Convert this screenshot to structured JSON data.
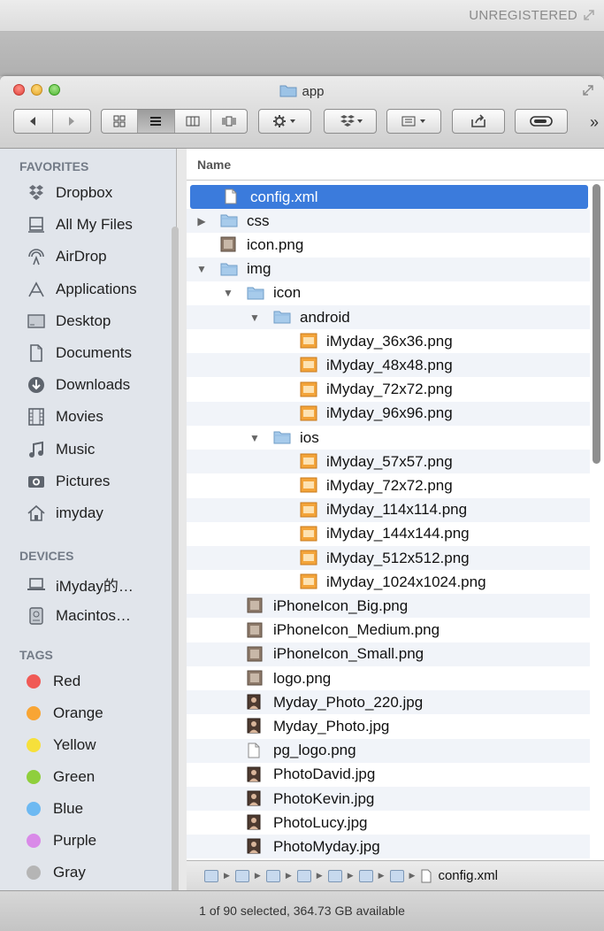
{
  "top": {
    "unregistered": "UNREGISTERED"
  },
  "window": {
    "title": "app",
    "more": "»"
  },
  "sidebar": {
    "favorites_header": "FAVORITES",
    "favorites": [
      {
        "label": "Dropbox",
        "icon": "dropbox-icon"
      },
      {
        "label": "All My Files",
        "icon": "all-my-files-icon"
      },
      {
        "label": "AirDrop",
        "icon": "airdrop-icon"
      },
      {
        "label": "Applications",
        "icon": "applications-icon"
      },
      {
        "label": "Desktop",
        "icon": "desktop-icon"
      },
      {
        "label": "Documents",
        "icon": "documents-icon"
      },
      {
        "label": "Downloads",
        "icon": "downloads-icon"
      },
      {
        "label": "Movies",
        "icon": "movies-icon"
      },
      {
        "label": "Music",
        "icon": "music-icon"
      },
      {
        "label": "Pictures",
        "icon": "pictures-icon"
      },
      {
        "label": "imyday",
        "icon": "home-icon"
      }
    ],
    "devices_header": "DEVICES",
    "devices": [
      {
        "label": "iMyday的…",
        "icon": "laptop-icon"
      },
      {
        "label": "Macintos…",
        "icon": "hard-drive-icon"
      }
    ],
    "tags_header": "TAGS",
    "tags": [
      {
        "label": "Red",
        "color": "#f05a56"
      },
      {
        "label": "Orange",
        "color": "#f8a534"
      },
      {
        "label": "Yellow",
        "color": "#f6e03b"
      },
      {
        "label": "Green",
        "color": "#8fcf3c"
      },
      {
        "label": "Blue",
        "color": "#6db9f2"
      },
      {
        "label": "Purple",
        "color": "#d98ae8"
      },
      {
        "label": "Gray",
        "color": "#b5b5b5"
      }
    ]
  },
  "files": {
    "column_name": "Name",
    "rows": [
      {
        "name": "config.xml",
        "type": "doc",
        "selected": true
      },
      {
        "name": "css",
        "type": "folder",
        "disclosure": "closed"
      },
      {
        "name": "icon.png",
        "type": "image"
      },
      {
        "name": "img",
        "type": "folder",
        "disclosure": "open"
      },
      {
        "name": "icon",
        "type": "folder",
        "disclosure": "open"
      },
      {
        "name": "android",
        "type": "folder",
        "disclosure": "open"
      },
      {
        "name": "iMyday_36x36.png",
        "type": "orange"
      },
      {
        "name": "iMyday_48x48.png",
        "type": "orange"
      },
      {
        "name": "iMyday_72x72.png",
        "type": "orange"
      },
      {
        "name": "iMyday_96x96.png",
        "type": "orange"
      },
      {
        "name": "ios",
        "type": "folder",
        "disclosure": "open"
      },
      {
        "name": "iMyday_57x57.png",
        "type": "orange"
      },
      {
        "name": "iMyday_72x72.png",
        "type": "orange"
      },
      {
        "name": "iMyday_114x114.png",
        "type": "orange"
      },
      {
        "name": "iMyday_144x144.png",
        "type": "orange"
      },
      {
        "name": "iMyday_512x512.png",
        "type": "orange"
      },
      {
        "name": "iMyday_1024x1024.png",
        "type": "orange"
      },
      {
        "name": "iPhoneIcon_Big.png",
        "type": "image"
      },
      {
        "name": "iPhoneIcon_Medium.png",
        "type": "image"
      },
      {
        "name": "iPhoneIcon_Small.png",
        "type": "image"
      },
      {
        "name": "logo.png",
        "type": "image"
      },
      {
        "name": "Myday_Photo_220.jpg",
        "type": "photo"
      },
      {
        "name": "Myday_Photo.jpg",
        "type": "photo"
      },
      {
        "name": "pg_logo.png",
        "type": "doc"
      },
      {
        "name": "PhotoDavid.jpg",
        "type": "photo"
      },
      {
        "name": "PhotoKevin.jpg",
        "type": "photo"
      },
      {
        "name": "PhotoLucy.jpg",
        "type": "photo"
      },
      {
        "name": "PhotoMyday.jpg",
        "type": "photo"
      }
    ]
  },
  "pathbar": {
    "current": "config.xml"
  },
  "status": {
    "text": "1 of 90 selected, 364.73 GB available"
  }
}
